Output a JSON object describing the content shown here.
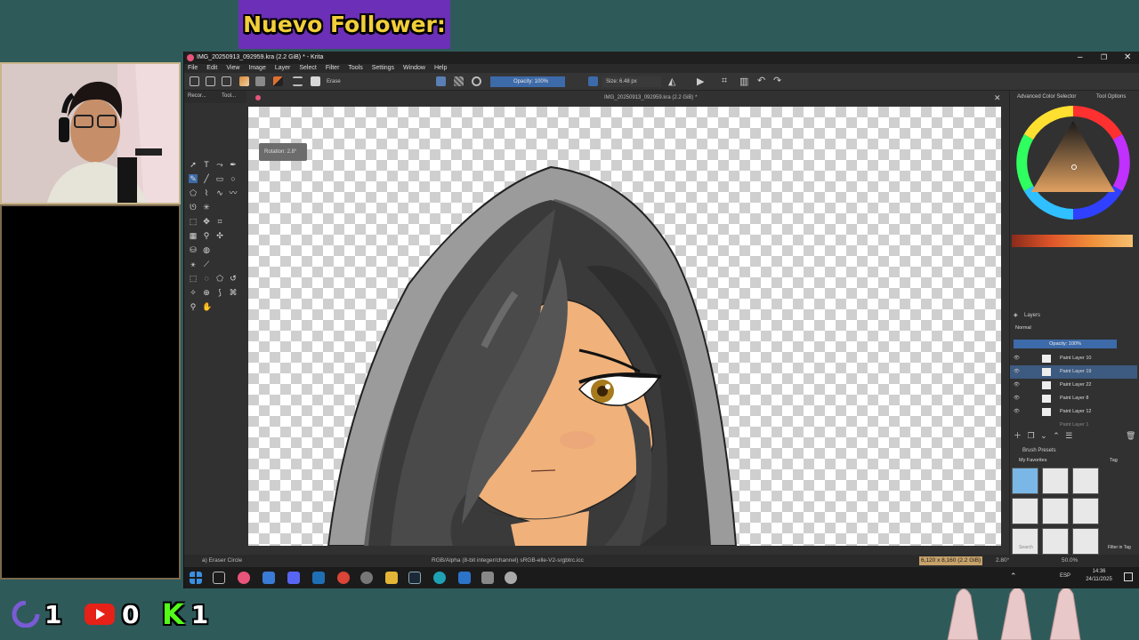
{
  "overlay": {
    "banner_text": "Nuevo Follower:",
    "twitch_count": "1",
    "youtube_count": "0",
    "kick_count": "1",
    "kick_letter": "K"
  },
  "app": {
    "title": "IMG_20250913_092959.kra (2.2 GiB) * - Krita",
    "document_tab": "IMG_20250913_092959.kra (2.2 GiB) *",
    "menu": [
      "File",
      "Edit",
      "View",
      "Image",
      "Layer",
      "Select",
      "Filter",
      "Tools",
      "Settings",
      "Window",
      "Help"
    ]
  },
  "toolbar": {
    "blend_mode": "Erase",
    "opacity": "Opacity: 100%",
    "size": "Size: 6.48 px"
  },
  "left_tabs": [
    "Recor...",
    "Tool..."
  ],
  "canvas": {
    "rotation_tip": "Rotation: 2.8°"
  },
  "right_dock": {
    "color_selector_title": "Advanced Color Selector",
    "tool_options_title": "Tool Options",
    "layers_title": "Layers",
    "blend_mode": "Normal",
    "opacity": "Opacity: 100%",
    "layers": [
      {
        "name": "Paint Layer 10",
        "active": false
      },
      {
        "name": "Paint Layer 19",
        "active": true
      },
      {
        "name": "Paint Layer 22",
        "active": false
      },
      {
        "name": "Paint Layer 8",
        "active": false
      },
      {
        "name": "Paint Layer 12",
        "active": false
      },
      {
        "name": "Paint Layer 1",
        "active": false
      }
    ],
    "brush_presets_title": "Brush Presets",
    "favorites": "My Favorites",
    "tag_label": "Tag",
    "search_placeholder": "Search",
    "filter_in_tag": "Filter in Tag"
  },
  "status": {
    "tool": "a) Eraser Circle",
    "color_space": "RGB/Alpha (8-bit integer/channel)  sRGB-elle-V2-srgbtrc.icc",
    "dimensions": "6,120 x 8,160 (2.2 GiB)",
    "rotation": "2.80°",
    "zoom": "50.0%"
  },
  "taskbar": {
    "lang": "ESP",
    "time": "14:36",
    "date": "24/11/2025"
  },
  "colors": {
    "banner_bg": "#6c2fb7",
    "banner_text": "#f2cf39",
    "active_layer": "#3d5a80"
  }
}
